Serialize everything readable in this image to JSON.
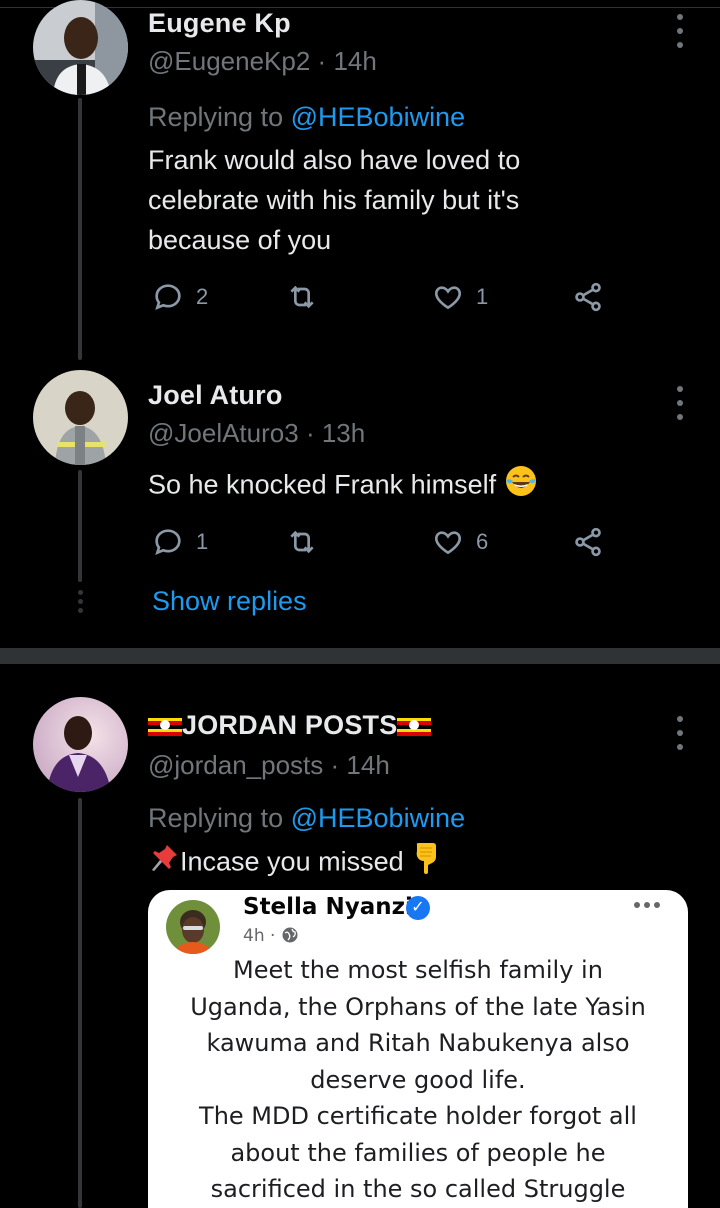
{
  "tweets": [
    {
      "name": "Eugene Kp",
      "handle": "@EugeneKp2",
      "time": "14h",
      "replying_prefix": "Replying to",
      "replying_to": "@HEBobiwine",
      "text_lines": [
        "Frank would also have loved to",
        "celebrate with his family  but it's",
        "because of you"
      ],
      "replies": "2",
      "retweets": "",
      "likes": "1"
    },
    {
      "name": "Joel Aturo",
      "handle": "@JoelAturo3",
      "time": "13h",
      "text": "So he knocked Frank himself",
      "emoji": "face-with-tears-of-joy",
      "replies": "1",
      "retweets": "",
      "likes": "6"
    },
    {
      "name": "JORDAN POSTS",
      "handle": "@jordan_posts",
      "time": "14h",
      "replying_prefix": "Replying to",
      "replying_to": "@HEBobiwine",
      "text": "Incase you missed",
      "emoji_before": "pushpin",
      "emoji_after": "backhand-index-pointing-down"
    }
  ],
  "show_replies": "Show replies",
  "separator_dot": "·",
  "embed": {
    "name": "Stella Nyanzi",
    "time": "4h",
    "dot": "·",
    "lines": [
      "Meet the most selfish family in",
      "Uganda, the Orphans of the late Yasin",
      "kawuma and Ritah Nabukenya also",
      "deserve good life.",
      "The MDD certificate holder forgot all",
      "about the families of people he",
      "sacrificed in the so called Struggle"
    ]
  },
  "colors": {
    "background": "#000000",
    "accent": "#1d9bf0",
    "secondary_text": "#71767b",
    "uganda_flag": [
      "#000000",
      "#fcdc04",
      "#d90000"
    ]
  }
}
